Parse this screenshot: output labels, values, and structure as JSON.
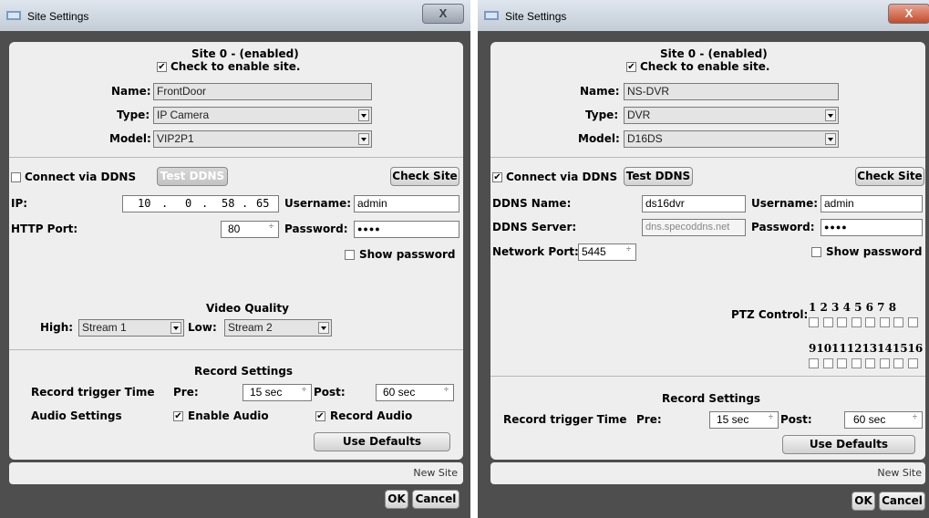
{
  "left": {
    "title": "Site Settings",
    "close": "X",
    "site_header": "Site 0 -  (enabled)",
    "enable_label": "Check to enable site.",
    "name_label": "Name:",
    "name_value": "FrontDoor",
    "type_label": "Type:",
    "type_value": "IP Camera",
    "model_label": "Model:",
    "model_value": "VIP2P1",
    "ddns_label": "Connect via DDNS",
    "test_ddns": "Test DDNS",
    "check_site": "Check Site",
    "ip_label": "IP:",
    "ip": [
      "10",
      "0",
      "58",
      "65"
    ],
    "dot": ".",
    "username_label": "Username:",
    "username_value": "admin",
    "http_port_label": "HTTP Port:",
    "http_port_value": "80",
    "password_label": "Password:",
    "password_value": "●●●●",
    "show_password": "Show password",
    "video_quality": "Video Quality",
    "high_label": "High:",
    "high_value": "Stream 1",
    "low_label": "Low:",
    "low_value": "Stream 2",
    "record_settings": "Record Settings",
    "record_trigger": "Record trigger Time",
    "pre_label": "Pre:",
    "pre_value": "15 sec",
    "post_label": "Post:",
    "post_value": "60 sec",
    "audio_settings": "Audio Settings",
    "enable_audio": "Enable Audio",
    "record_audio": "Record Audio",
    "use_defaults": "Use Defaults",
    "new_site": "New Site",
    "ok": "OK",
    "cancel": "Cancel",
    "check_mark": "✔"
  },
  "right": {
    "title": "Site Settings",
    "close": "X",
    "site_header": "Site 0 -  (enabled)",
    "enable_label": "Check to enable site.",
    "name_label": "Name:",
    "name_value": "NS-DVR",
    "type_label": "Type:",
    "type_value": "DVR",
    "model_label": "Model:",
    "model_value": "D16DS",
    "ddns_label": "Connect via DDNS",
    "test_ddns": "Test DDNS",
    "check_site": "Check Site",
    "ddns_name_label": "DDNS Name:",
    "ddns_name_value": "ds16dvr",
    "username_label": "Username:",
    "username_value": "admin",
    "ddns_server_label": "DDNS Server:",
    "ddns_server_value": "dns.specoddns.net",
    "password_label": "Password:",
    "password_value": "●●●●",
    "network_port_label": "Network Port:",
    "network_port_value": "5445",
    "show_password": "Show password",
    "ptz_label": "PTZ Control:",
    "ptz_row1": "1 2 3 4 5 6 7 8",
    "ptz_row2": "910111213141516",
    "record_settings": "Record Settings",
    "record_trigger": "Record trigger Time",
    "pre_label": "Pre:",
    "pre_value": "15 sec",
    "post_label": "Post:",
    "post_value": "60 sec",
    "use_defaults": "Use Defaults",
    "new_site": "New Site",
    "ok": "OK",
    "cancel": "Cancel",
    "check_mark": "✔"
  },
  "spinner_glyph": "÷"
}
